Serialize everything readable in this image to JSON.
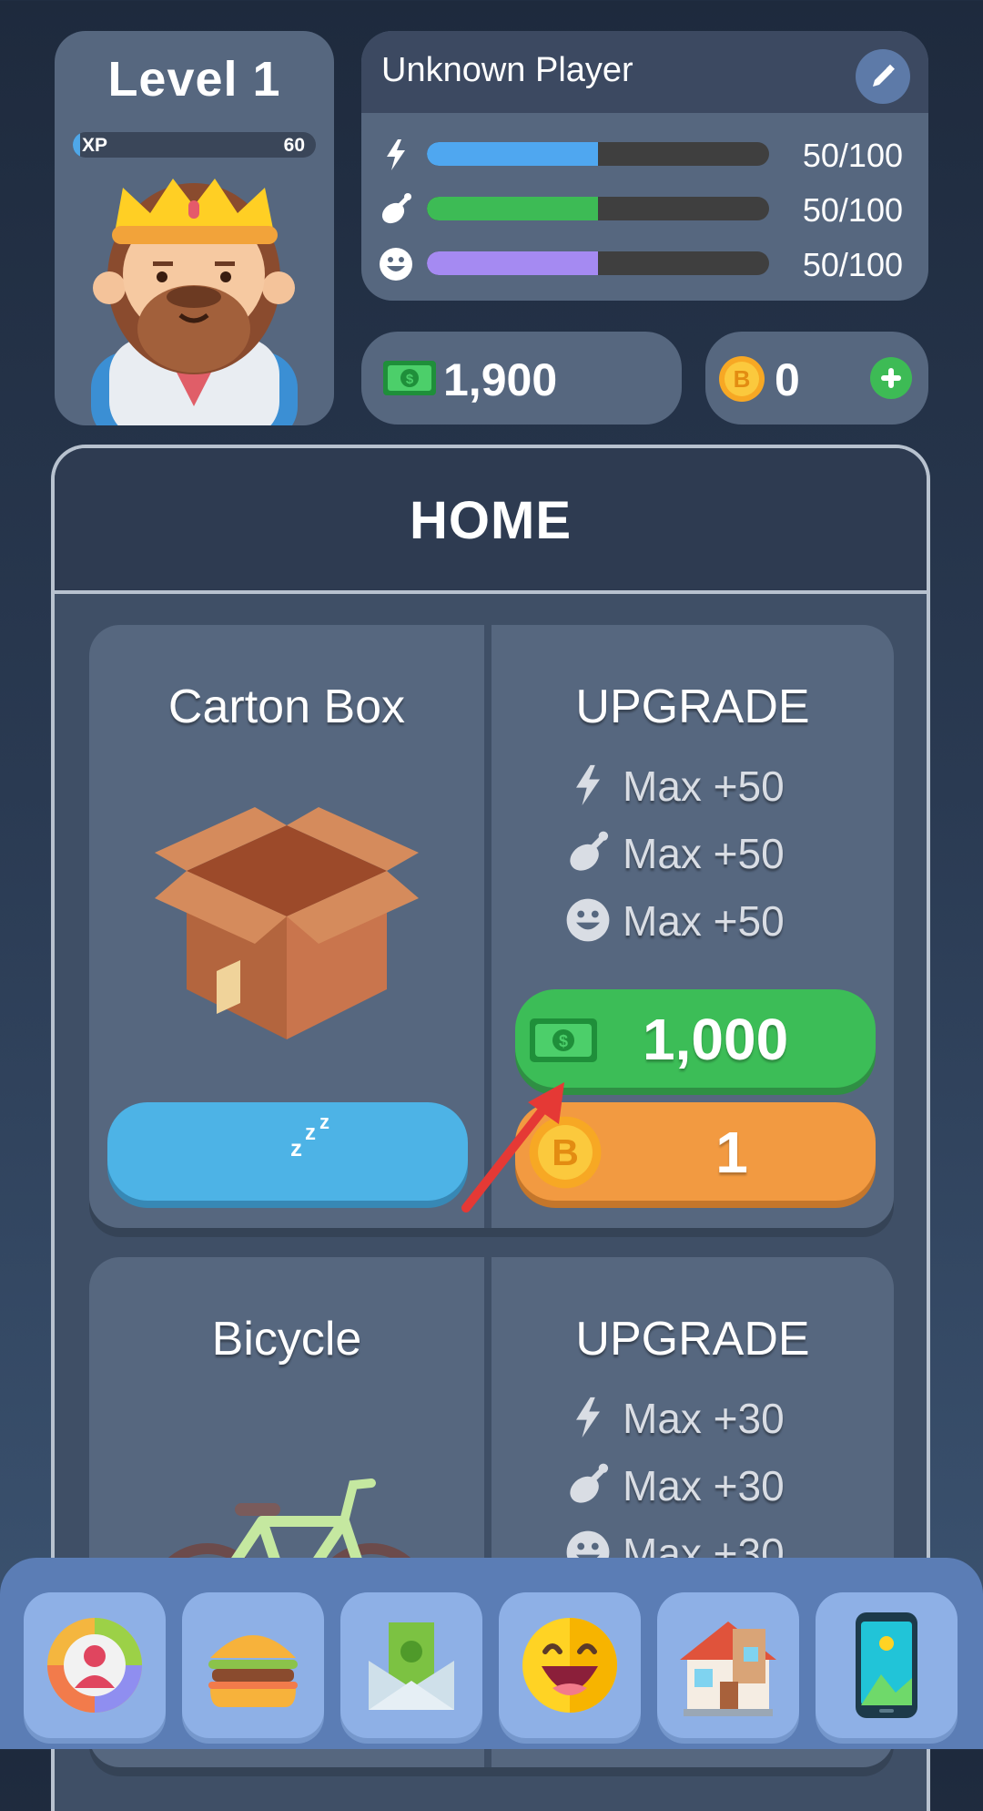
{
  "level_card": {
    "title": "Level 1",
    "xp_label": "XP",
    "xp_value": "60",
    "xp_fraction": 0.03
  },
  "player": {
    "name": "Unknown Player",
    "stats": [
      {
        "icon": "energy-icon",
        "value": "50/100",
        "fraction": 0.5,
        "color": "#4fa7f0"
      },
      {
        "icon": "food-icon",
        "value": "50/100",
        "fraction": 0.5,
        "color": "#3dbb55"
      },
      {
        "icon": "happiness-icon",
        "value": "50/100",
        "fraction": 0.5,
        "color": "#a58af2"
      }
    ]
  },
  "currency": {
    "cash": "1,900",
    "coins": "0"
  },
  "home": {
    "title": "HOME",
    "items": [
      {
        "name": "Carton Box",
        "upgrade_label": "UPGRADE",
        "bonuses": [
          "Max +50",
          "Max +50",
          "Max +50"
        ],
        "cash_price": "1,000",
        "coin_price": "1"
      },
      {
        "name": "Bicycle",
        "upgrade_label": "UPGRADE",
        "bonuses": [
          "Max +30",
          "Max +30",
          "Max +30"
        ]
      }
    ]
  },
  "nav": [
    "profile-wheel-icon",
    "burger-icon",
    "money-envelope-icon",
    "smiley-icon",
    "house-icon",
    "smartphone-icon"
  ],
  "colors": {
    "cash_button": "#3cbd57",
    "coin_button": "#f29a41",
    "sleep_button": "#4db3e6",
    "panel": "#56677f"
  }
}
